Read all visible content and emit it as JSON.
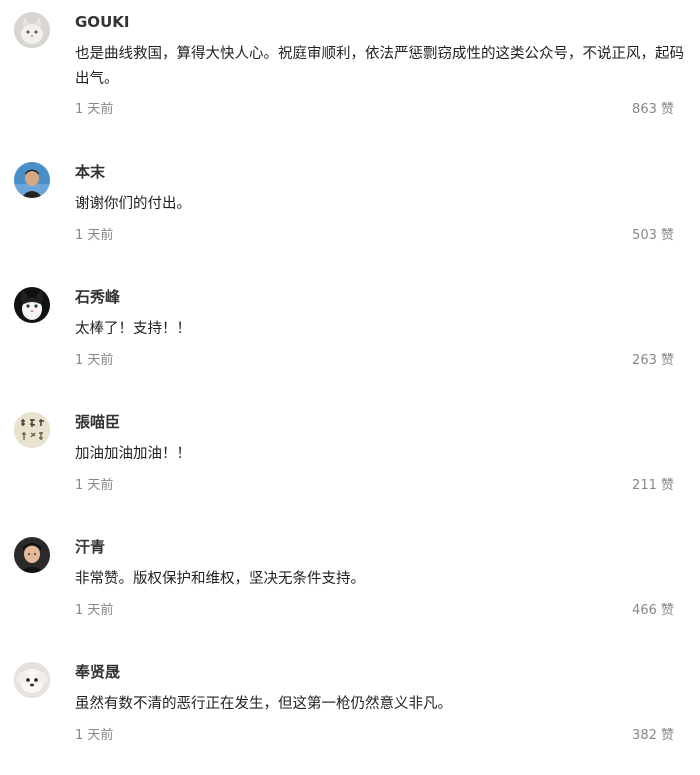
{
  "comments": [
    {
      "nickname": "GOUKI",
      "content": "也是曲线救国，算得大快人心。祝庭审顺利，依法严惩剽窃成性的这类公众号，不说正风，起码出气。",
      "time": "1 天前",
      "likes": "863 赞",
      "avatar_icon": "cat-avatar"
    },
    {
      "nickname": "本末",
      "content": "谢谢你们的付出。",
      "time": "1 天前",
      "likes": "503 赞",
      "avatar_icon": "person-avatar"
    },
    {
      "nickname": "石秀峰",
      "content": "太棒了！支持！！",
      "time": "1 天前",
      "likes": "263 赞",
      "avatar_icon": "cat-bw-avatar"
    },
    {
      "nickname": "張喵臣",
      "content": "加油加油加油！！",
      "time": "1 天前",
      "likes": "211 赞",
      "avatar_icon": "calligraphy-avatar"
    },
    {
      "nickname": "汗青",
      "content": "非常赞。版权保护和维权，坚决无条件支持。",
      "time": "1 天前",
      "likes": "466 赞",
      "avatar_icon": "person-avatar"
    },
    {
      "nickname": "奉贤晟",
      "content": "虽然有数不清的恶行正在发生，但这第一枪仍然意义非凡。",
      "time": "1 天前",
      "likes": "382 赞",
      "avatar_icon": "dog-avatar"
    }
  ]
}
